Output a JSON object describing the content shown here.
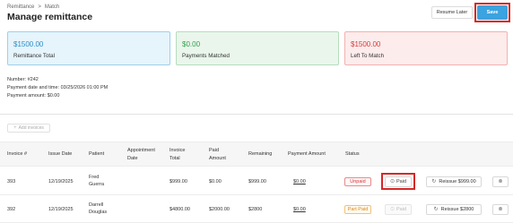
{
  "breadcrumb": {
    "root": "Remittance",
    "separator": ">",
    "current": "Match"
  },
  "page_title": "Manage remittance",
  "header_actions": {
    "resume_label": "Resume Later",
    "save_label": "Save"
  },
  "summary": {
    "total": {
      "amount": "$1500.00",
      "label": "Remittance Total"
    },
    "matched": {
      "amount": "$0.00",
      "label": "Payments Matched"
    },
    "left": {
      "amount": "$1500.00",
      "label": "Left To Match"
    }
  },
  "meta": {
    "number": "Number: #242",
    "datetime": "Payment date and time: 03/25/2026 01:00 PM",
    "amount": "Payment amount: $0.00"
  },
  "add_invoices_label": "Add invoices",
  "table": {
    "headers": {
      "invoice": "Invoice #",
      "issue_date": "Issue Date",
      "patient": "Patient",
      "appt_1": "Appointment",
      "appt_2": "Date",
      "total_1": "Invoice",
      "total_2": "Total",
      "paid_1": "Paid",
      "paid_2": "Amount",
      "remaining": "Remaining",
      "payment_amount": "Payment Amount",
      "status": "Status"
    },
    "rows": [
      {
        "invoice": "393",
        "issue_date": "12/19/2025",
        "patient_1": "Fred",
        "patient_2": "Guerra",
        "appt_date": "",
        "total": "$999.00",
        "paid": "$0.00",
        "remaining": "$999.00",
        "payment_amount": "$0.00",
        "status": "Unpaid",
        "paid_btn": "Paid",
        "reissue_btn": "Reissue $999.00"
      },
      {
        "invoice": "392",
        "issue_date": "12/19/2025",
        "patient_1": "Darrell",
        "patient_2": "Douglas",
        "appt_date": "",
        "total": "$4800.00",
        "paid": "$2000.00",
        "remaining": "$2800",
        "payment_amount": "$0.00",
        "status": "Part Paid",
        "paid_btn": "Paid",
        "reissue_btn": "Reissue $2800"
      }
    ]
  },
  "icons": {
    "add": "plus-icon",
    "paid": "check-circle-icon",
    "reissue": "refresh-icon",
    "remove": "close-circle-icon"
  },
  "colors": {
    "save": "#3aa3e0",
    "highlight": "#d62828",
    "unpaid": "#d63a3a",
    "part_paid": "#d58a1f",
    "matched": "#2f9e4b"
  }
}
